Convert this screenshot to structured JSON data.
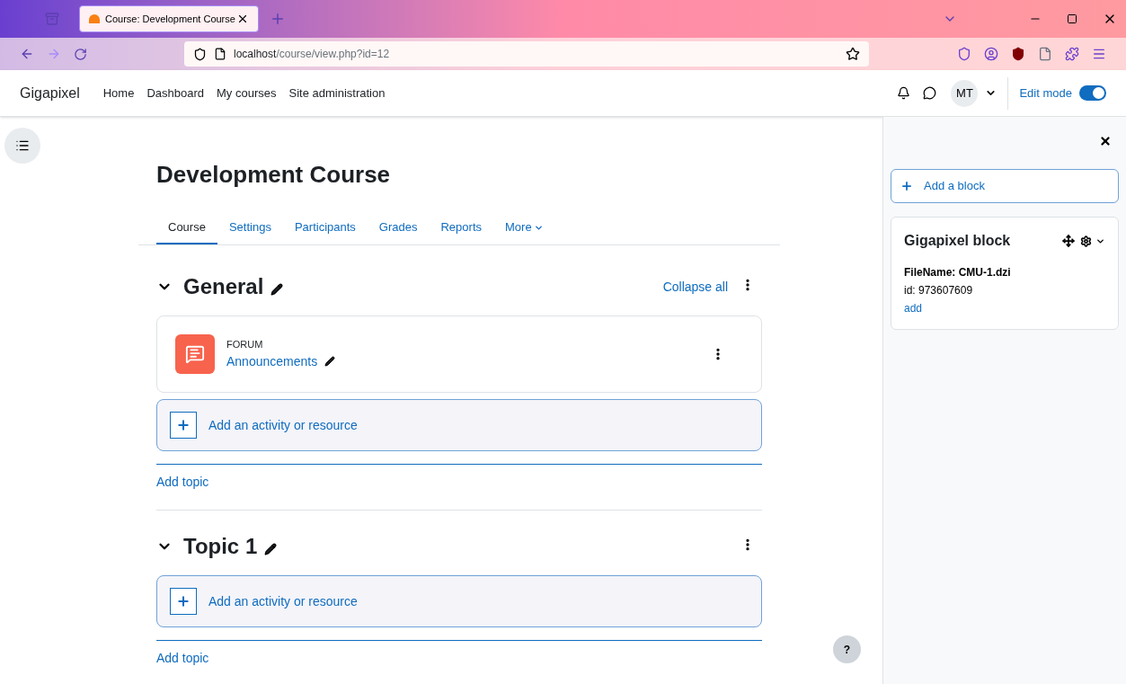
{
  "browser": {
    "tab": {
      "title": "Course: Development Course",
      "selected": true
    },
    "url_host": "localhost",
    "url_path": "/course/view.php?id=12"
  },
  "navbar": {
    "brand": "Gigapixel",
    "links": [
      "Home",
      "Dashboard",
      "My courses",
      "Site administration"
    ],
    "avatar": "MT",
    "edit_mode": {
      "label": "Edit mode",
      "on": true
    }
  },
  "course": {
    "title": "Development Course",
    "tabs": [
      {
        "label": "Course",
        "selected": true
      },
      {
        "label": "Settings",
        "selected": false
      },
      {
        "label": "Participants",
        "selected": false
      },
      {
        "label": "Grades",
        "selected": false
      },
      {
        "label": "Reports",
        "selected": false
      },
      {
        "label": "More",
        "selected": false
      }
    ],
    "collapse_all": "Collapse all"
  },
  "sections": [
    {
      "title": "General",
      "expanded": true,
      "activities": [
        {
          "type": "FORUM",
          "name": "Announcements"
        }
      ],
      "add_activity": "Add an activity or resource",
      "add_topic": "Add topic"
    },
    {
      "title": "Topic 1",
      "expanded": true,
      "add_activity": "Add an activity or resource",
      "add_topic": "Add topic"
    }
  ],
  "help": "?",
  "drawer": {
    "add_block": "Add a block",
    "block": {
      "title": "Gigapixel block",
      "filename": "FileName: CMU-1.dzi",
      "id": "id: 973607609",
      "link": "add"
    }
  }
}
